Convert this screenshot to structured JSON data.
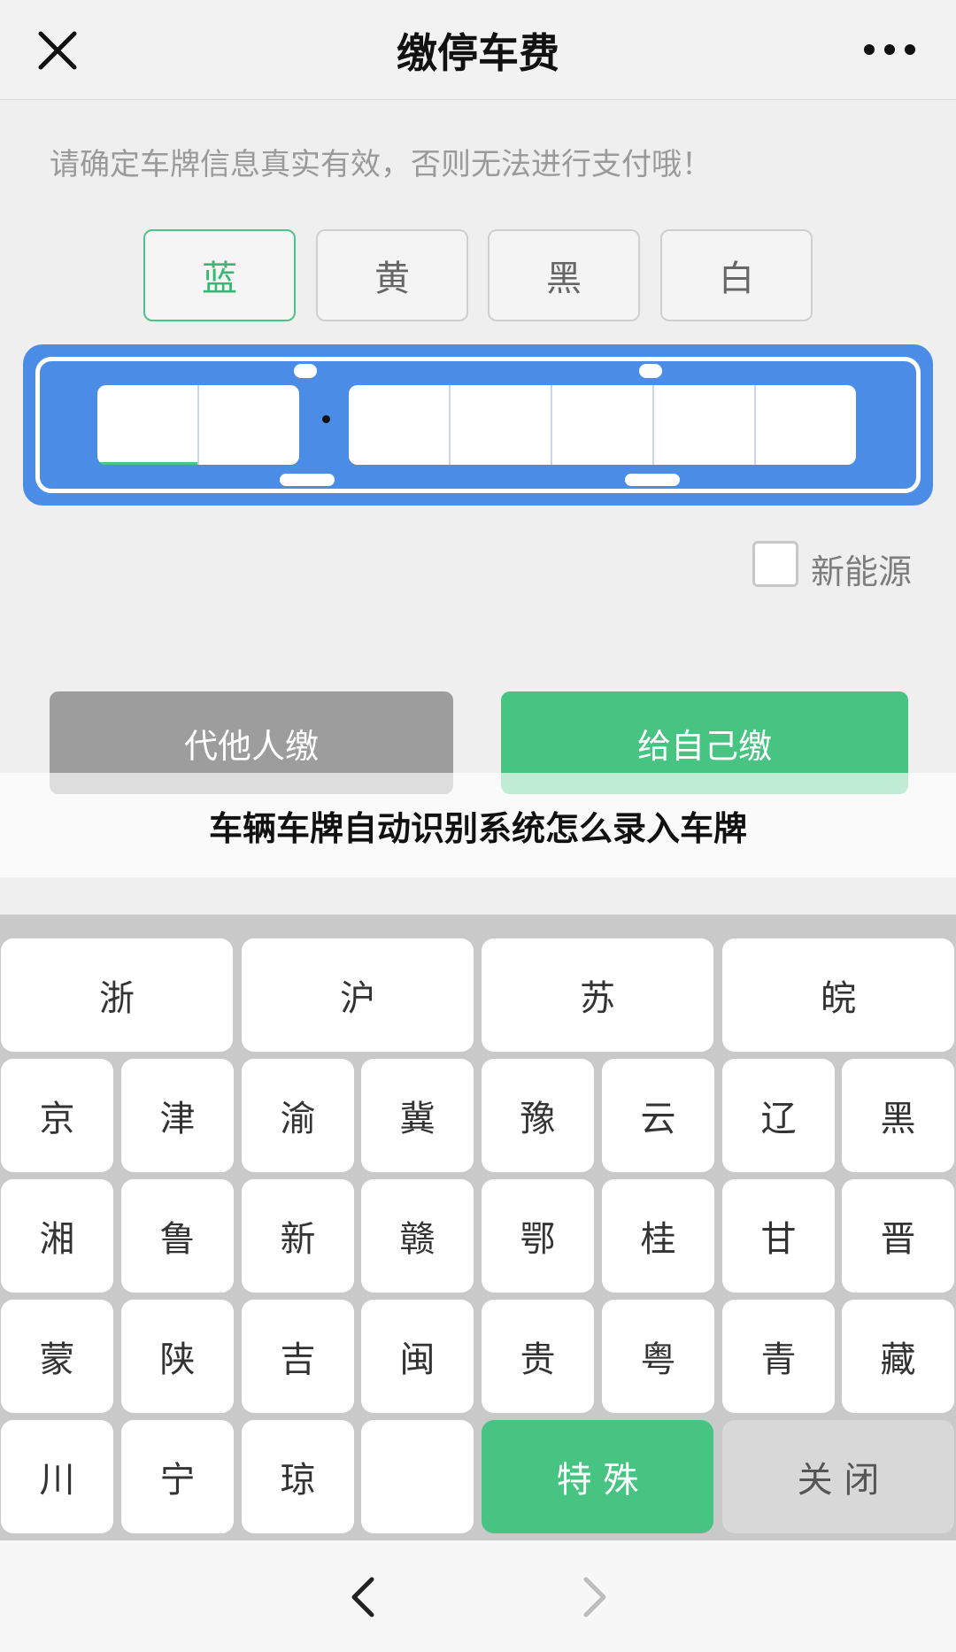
{
  "header": {
    "title": "缴停车费"
  },
  "notice": "请确定车牌信息真实有效，否则无法进行支付哦！",
  "plate_colors": [
    {
      "label": "蓝",
      "active": true
    },
    {
      "label": "黄",
      "active": false
    },
    {
      "label": "黑",
      "active": false
    },
    {
      "label": "白",
      "active": false
    }
  ],
  "new_energy_label": "新能源",
  "buttons": {
    "pay_for_others": "代他人缴",
    "pay_for_self": "给自己缴"
  },
  "caption": "车辆车牌自动识别系统怎么录入车牌",
  "keyboard": {
    "row1": [
      "浙",
      "沪",
      "苏",
      "皖"
    ],
    "row2": [
      "京",
      "津",
      "渝",
      "冀",
      "豫",
      "云",
      "辽",
      "黑"
    ],
    "row3": [
      "湘",
      "鲁",
      "新",
      "赣",
      "鄂",
      "桂",
      "甘",
      "晋"
    ],
    "row4": [
      "蒙",
      "陕",
      "吉",
      "闽",
      "贵",
      "粤",
      "青",
      "藏"
    ],
    "row5": [
      "川",
      "宁",
      "琼",
      ""
    ],
    "special": "特 殊",
    "close": "关 闭"
  },
  "colors": {
    "accent_green": "#47c481",
    "plate_blue": "#4b8de6",
    "disabled_gray": "#9d9d9d"
  }
}
